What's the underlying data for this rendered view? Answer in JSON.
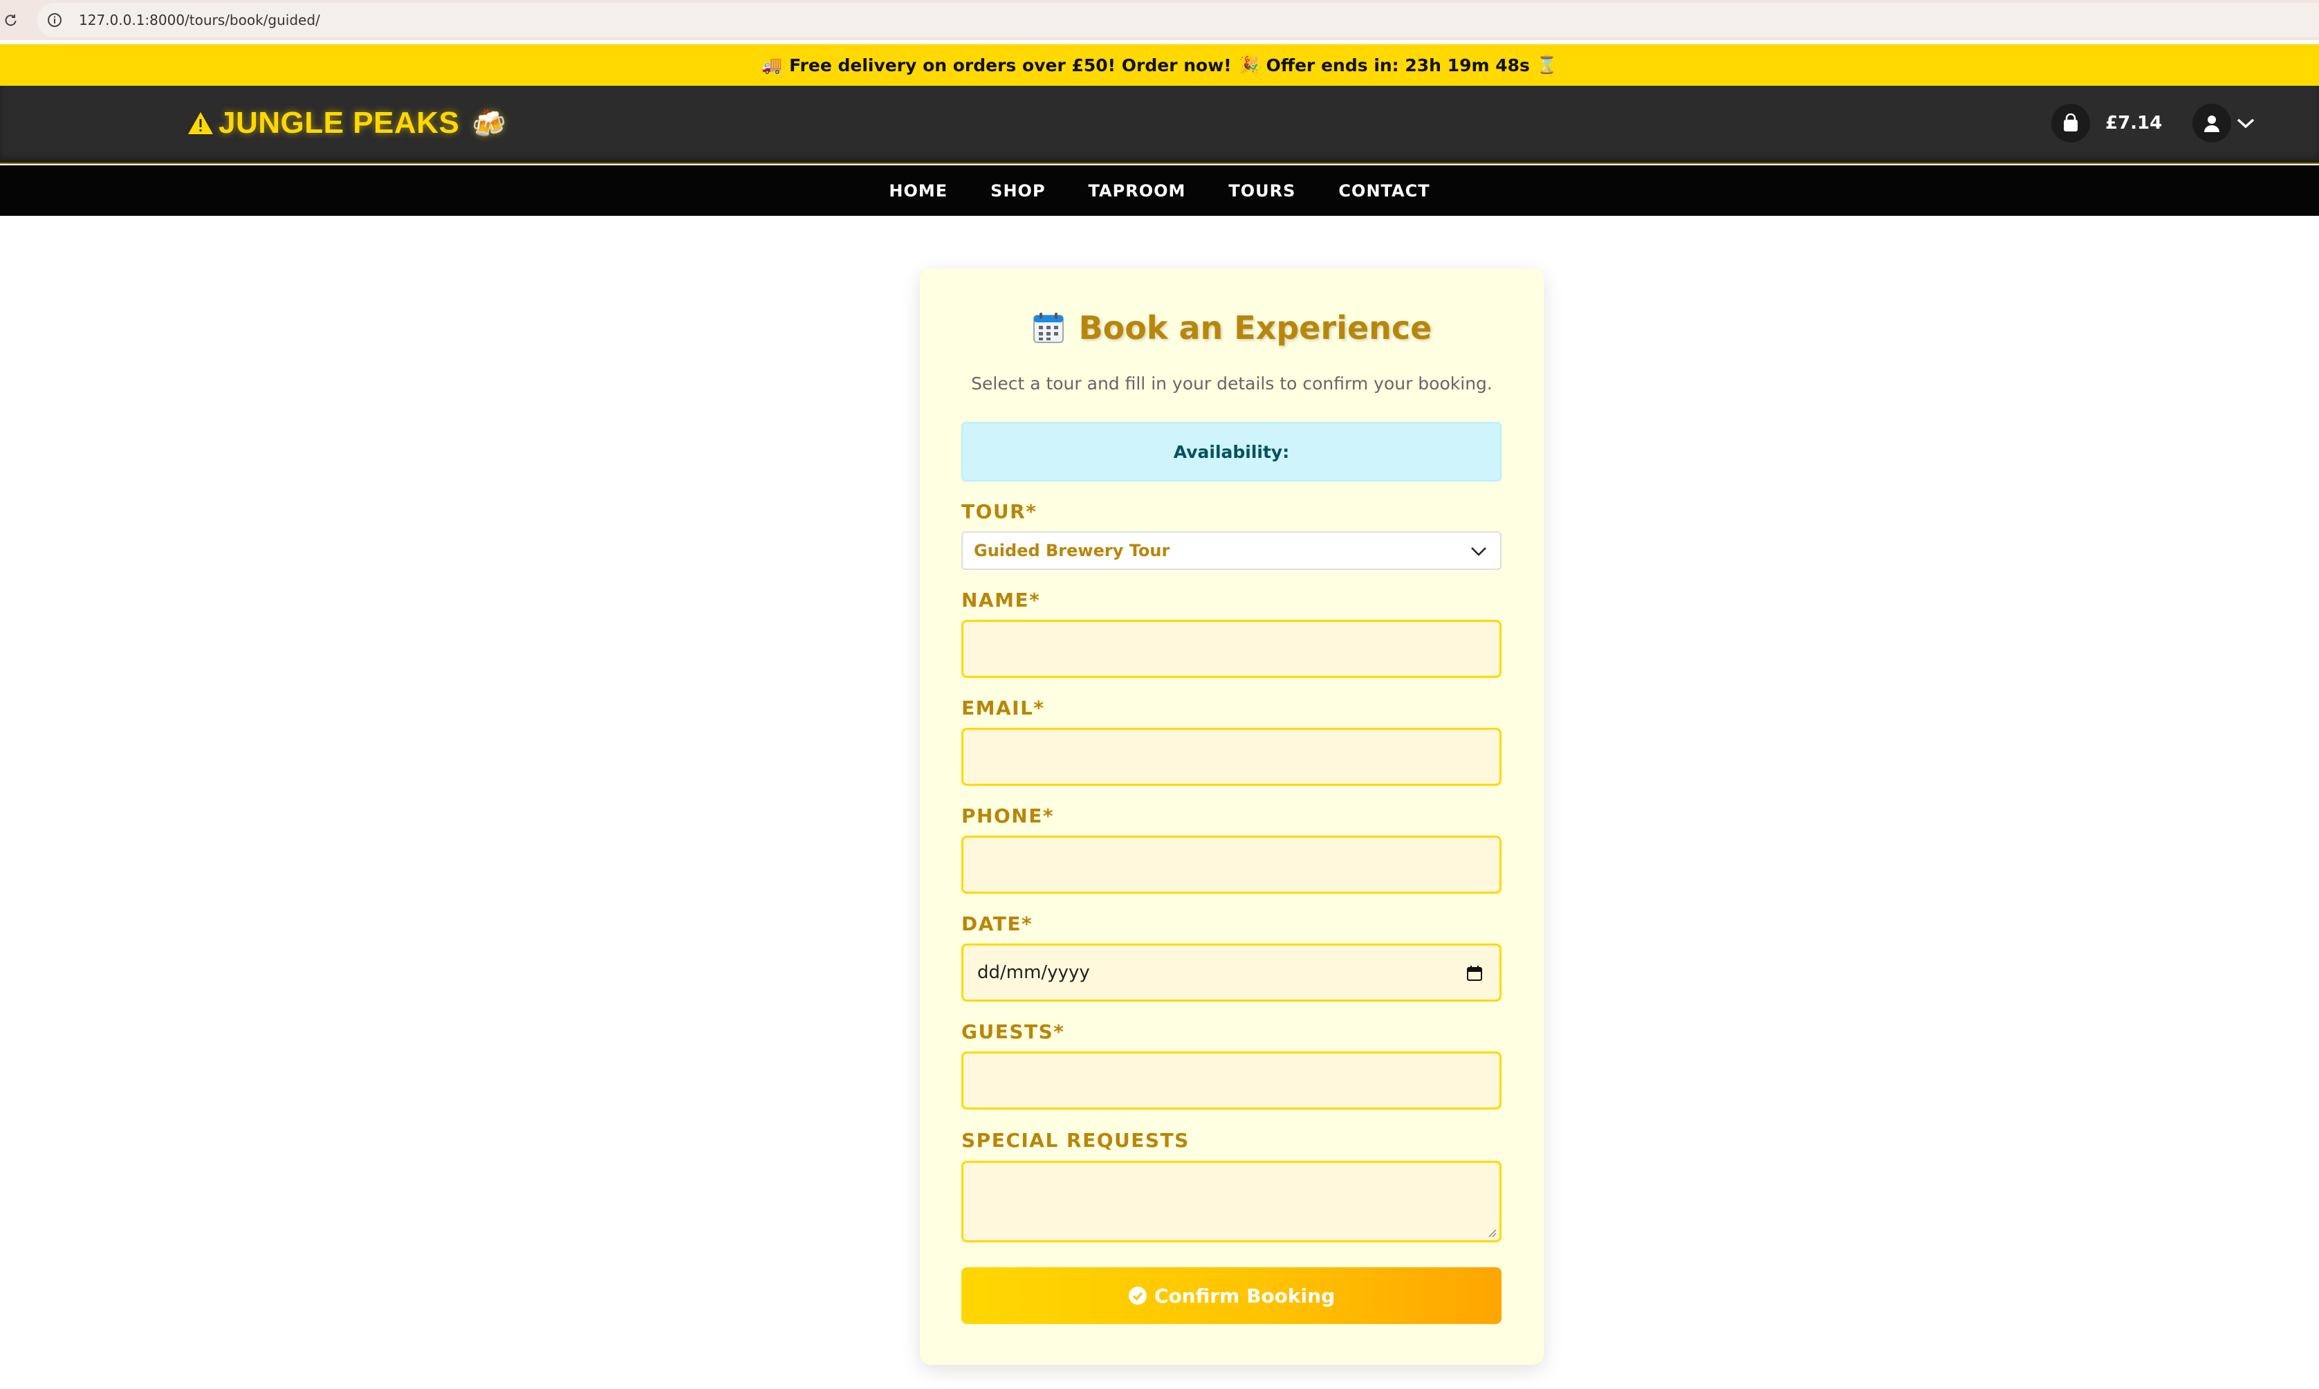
{
  "browser": {
    "url": "127.0.0.1:8000/tours/book/guided/"
  },
  "promo": {
    "truck_emoji": "🚚",
    "text": "Free delivery on orders over £50! Order now!",
    "party_emoji": "🎉",
    "countdown": "Offer ends in: 23h 19m 48s",
    "hourglass_emoji": "⌛"
  },
  "header": {
    "logo_text": "JUNGLE PEAKS",
    "logo_emoji": "🍻",
    "cart_total": "£7.14"
  },
  "nav": {
    "items": [
      "HOME",
      "SHOP",
      "TAPROOM",
      "TOURS",
      "CONTACT"
    ]
  },
  "booking": {
    "title": "Book an Experience",
    "subtitle": "Select a tour and fill in your details to confirm your booking.",
    "availability_label": "Availability:",
    "tour_label": "TOUR*",
    "tour_selected": "Guided Brewery Tour",
    "name_label": "NAME*",
    "email_label": "EMAIL*",
    "phone_label": "PHONE*",
    "date_label": "DATE*",
    "date_placeholder": "dd/mm/yyyy",
    "guests_label": "GUESTS*",
    "special_label": "SPECIAL REQUESTS",
    "submit_label": "Confirm Booking"
  },
  "colors": {
    "brand_yellow": "#ffd900",
    "gold_text": "#b8860b",
    "header_dark": "#2c2c2c",
    "nav_black": "#050505",
    "card_bg": "#ffffe1",
    "info_bg": "#cff4fc",
    "button_gradient_end": "#ffa500"
  },
  "icons": {
    "reload": "reload-icon",
    "info": "info-icon",
    "warning": "warning-triangle-icon",
    "cart": "shopping-bag-icon",
    "user": "user-icon",
    "chevron": "chevron-down-icon",
    "calendar": "calendar-icon",
    "date_picker": "calendar-small-icon",
    "check": "check-circle-icon"
  }
}
